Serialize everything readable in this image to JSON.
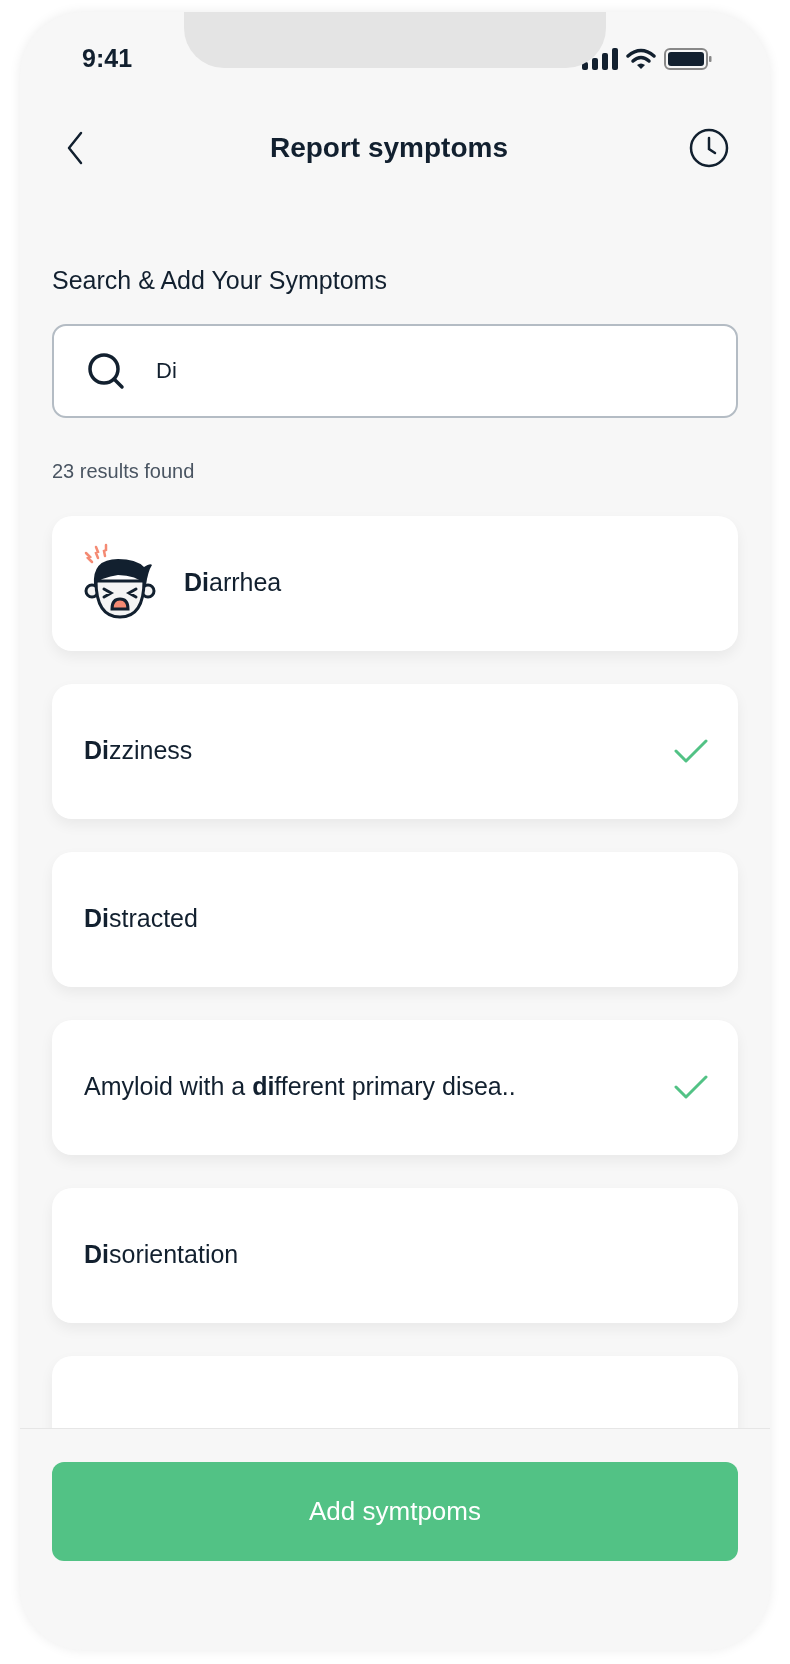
{
  "status_bar": {
    "time": "9:41"
  },
  "header": {
    "title": "Report symptoms"
  },
  "search": {
    "label": "Search & Add Your Symptoms",
    "value": "Di"
  },
  "results_count": "23 results found",
  "results": [
    {
      "kind": "illustrated",
      "label": "**Di**arrhea",
      "checked": false
    },
    {
      "kind": "plain",
      "label": "**Di**zziness",
      "checked": true
    },
    {
      "kind": "plain",
      "label": "**Di**stracted",
      "checked": false
    },
    {
      "kind": "plain",
      "label": "Amyloid with a **di**fferent primary disea..",
      "checked": true
    },
    {
      "kind": "plain",
      "label": "**Di**sorientation",
      "checked": false
    },
    {
      "kind": "hidden"
    }
  ],
  "footer": {
    "button": "Add symtpoms"
  }
}
